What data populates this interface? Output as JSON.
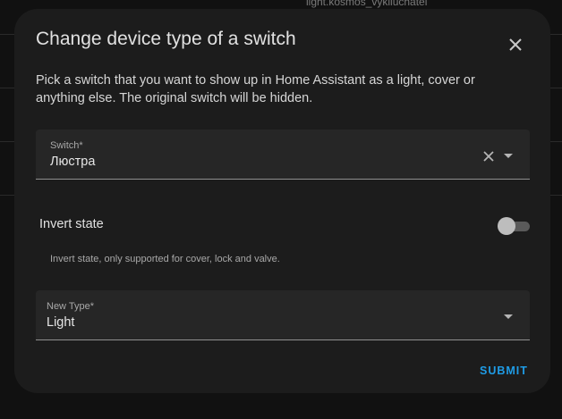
{
  "background": {
    "text": "light.kosmos_vykliuchatel"
  },
  "dialog": {
    "title": "Change device type of a switch",
    "description": "Pick a switch that you want to show up in Home Assistant as a light, cover or anything else. The original switch will be hidden.",
    "switch_field": {
      "label": "Switch*",
      "value": "Люстра"
    },
    "invert": {
      "label": "Invert state",
      "enabled": false,
      "helper": "Invert state, only supported for cover, lock and valve."
    },
    "type_field": {
      "label": "New Type*",
      "value": "Light"
    },
    "submit_label": "SUBMIT"
  },
  "colors": {
    "accent": "#1f9ce6",
    "dialog_bg": "#1c1c1c",
    "field_bg": "#262626"
  }
}
